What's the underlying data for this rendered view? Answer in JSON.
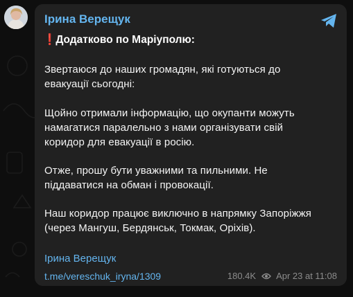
{
  "channel": {
    "author_name": "Ірина Верещук"
  },
  "message": {
    "headline_icon": "❗",
    "headline": "Додатково по Маріуполю:",
    "paragraphs": [
      [
        "Звертаюся до наших громадян, які готуються до",
        "евакуації сьогодні:"
      ],
      [
        "Щойно отримали інформацію, що окупанти можуть",
        "намагатися паралельно з нами організувати свій",
        "коридор для евакуації в росію."
      ],
      [
        "Отже, прошу бути уважними та пильними. Не",
        "піддаватися на обман і провокації."
      ],
      [
        "Наш коридор працює виключно в напрямку Запоріжжя",
        "(через Мангуш, Бердянськ, Токмак, Оріхів)."
      ]
    ],
    "signature": "Ірина Верещук",
    "link": "t.me/vereschuk_iryna/1309",
    "views": "180.4K",
    "timestamp": "Apr 23 at 11:08"
  },
  "icons": {
    "share": "telegram-share-icon",
    "views": "eye-icon",
    "avatar": "avatar"
  },
  "colors": {
    "background": "#0e0e0e",
    "bubble": "#212121",
    "accent": "#64b5ef",
    "text": "#f5f5f5",
    "meta": "#8c8c8c",
    "alert": "#e53935"
  }
}
